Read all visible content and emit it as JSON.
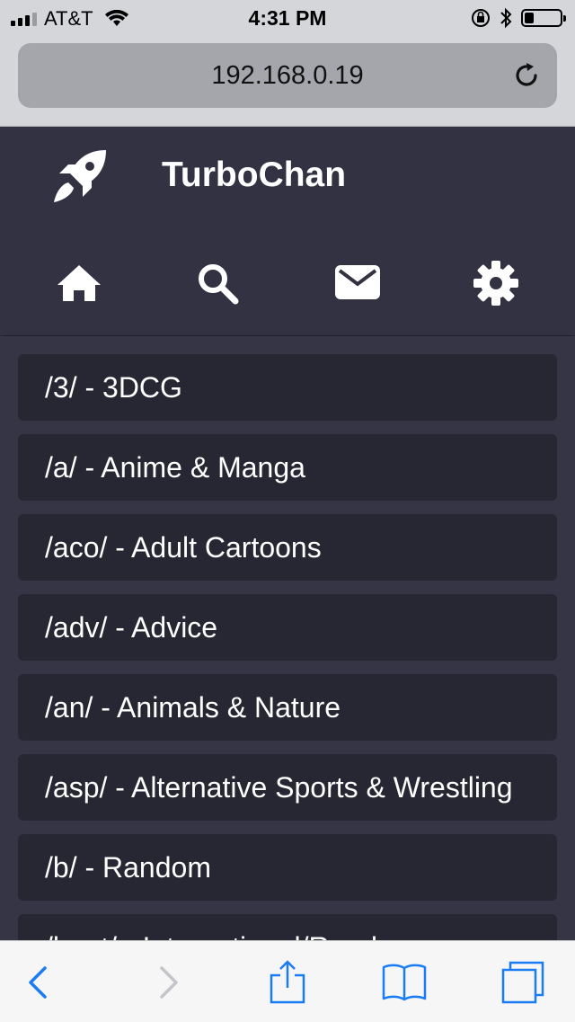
{
  "status_bar": {
    "carrier": "AT&T",
    "time": "4:31 PM",
    "battery_level": 0.25
  },
  "browser": {
    "url": "192.168.0.19"
  },
  "site": {
    "title": "TurboChan",
    "nav": [
      "home-icon",
      "search-icon",
      "mail-icon",
      "gear-icon"
    ]
  },
  "boards": [
    "/3/ - 3DCG",
    "/a/ - Anime & Manga",
    "/aco/ - Adult Cartoons",
    "/adv/ - Advice",
    "/an/ - Animals & Nature",
    "/asp/ - Alternative Sports & Wrestling",
    "/b/ - Random",
    "/bant/ - International/Random"
  ],
  "colors": {
    "header_bg": "#323242",
    "page_bg": "#353545",
    "item_bg": "#272734",
    "ios_blue": "#1a7cf5"
  }
}
